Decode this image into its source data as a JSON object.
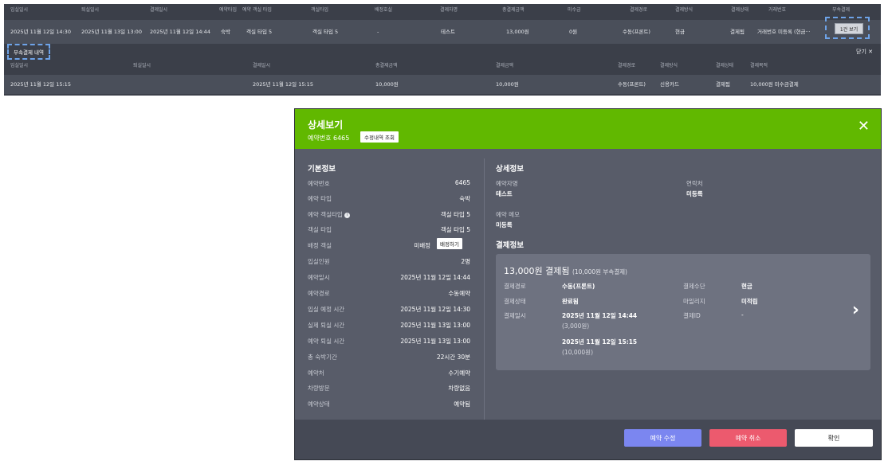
{
  "table1": {
    "headers": [
      "입실일시",
      "퇴실일시",
      "결제일시",
      "예약타입",
      "예약 객실 타입",
      "객실타입",
      "배정호실",
      "결제자명",
      "총결제금액",
      "미수금",
      "결제경로",
      "결제방식",
      "결제상태",
      "거래번호",
      "부속결제"
    ],
    "row": [
      "2025년 11월 12일 14:30",
      "2025년 11월 13일 13:00",
      "2025년 11월 12일 14:44",
      "숙박",
      "객실 타입 5",
      "객실 타입 5",
      "-",
      "테스트",
      "13,000원",
      "0원",
      "수동(프론트)",
      "현금",
      "결제됨",
      "거래번호 미등록 (현금···"
    ],
    "one_button": "1건 보기"
  },
  "sub_payment": {
    "label": "부속결제 내역",
    "close": "닫기 ✕",
    "headers": [
      "입실일시",
      "퇴실일시",
      "결제일시",
      "총결제금액",
      "결제금액",
      "결제경로",
      "결제방식",
      "결제상태",
      "결제목적"
    ],
    "row": [
      "2025년 11월 12일 15:15",
      "",
      "2025년 11월 12일 15:15",
      "10,000원",
      "10,000원",
      "수동(프론트)",
      "신용카드",
      "결제됨",
      "10,000원 미수금결제"
    ]
  },
  "modal": {
    "title": "상세보기",
    "booking_no_text": "예약번호 6465",
    "edit_history_button": "수정내역 조회",
    "close_icon": "✕",
    "basic": {
      "title": "기본정보",
      "items": [
        {
          "label": "예약번호",
          "value": "6465"
        },
        {
          "label": "예약 타입",
          "value": "숙박"
        },
        {
          "label": "예약 객실타입",
          "value": "객실 타입 5"
        },
        {
          "label": "객실 타입",
          "value": "객실 타입 5"
        },
        {
          "label": "배정 객실",
          "value": "미배정"
        },
        {
          "label": "입실인원",
          "value": "2명"
        },
        {
          "label": "예약일시",
          "value": "2025년 11월 12일 14:44"
        },
        {
          "label": "예약경로",
          "value": "수동예약"
        },
        {
          "label": "입실 예정 시간",
          "value": "2025년 11월 12일 14:30"
        },
        {
          "label": "실제 퇴실 시간",
          "value": "2025년 11월 13일 13:00"
        },
        {
          "label": "예약 퇴실 시간",
          "value": "2025년 11월 13일 13:00"
        },
        {
          "label": "총 숙박기간",
          "value": "22시간 30분"
        },
        {
          "label": "예약처",
          "value": "수기예약"
        },
        {
          "label": "차량방문",
          "value": "차량없음"
        },
        {
          "label": "예약상태",
          "value": "예약됨"
        }
      ],
      "info_glyph": "i",
      "assign_button": "배정하기"
    },
    "detail": {
      "title": "상세정보",
      "booker_label": "예약자명",
      "booker_value": "테스트",
      "contact_label": "연락처",
      "contact_value": "미등록",
      "memo_label": "예약 메모",
      "memo_value": "미등록"
    },
    "payment": {
      "title": "결제정보",
      "card_title": "13,000원 결제됨",
      "card_sub": "(10,000원 부속결제)",
      "route_label": "결제경로",
      "route_value": "수동(프론트)",
      "method_label": "결제수단",
      "method_value": "현금",
      "status_label": "결제상태",
      "status_value": "완료됨",
      "mileage_label": "마일리지",
      "mileage_value": "미적립",
      "date_label": "결제일시",
      "date1": "2025년 11월 12일 14:44",
      "amount1": "(3,000원)",
      "date2": "2025년 11월 12일 15:15",
      "amount2": "(10,000원)",
      "id_label": "결제ID",
      "id_value": "-",
      "chevron": "›"
    },
    "footer": {
      "edit": "예약 수정",
      "cancel": "예약 취소",
      "ok": "확인"
    }
  }
}
